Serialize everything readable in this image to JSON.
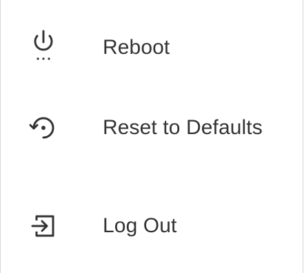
{
  "menu": {
    "items": [
      {
        "label": "Reboot",
        "icon": "power-icon"
      },
      {
        "label": "Reset to Defaults",
        "icon": "restore-icon"
      },
      {
        "label": "Log Out",
        "icon": "logout-icon"
      }
    ]
  },
  "colors": {
    "text": "#333333",
    "icon": "#333333",
    "border": "#d6d6d6",
    "background": "#ffffff"
  }
}
